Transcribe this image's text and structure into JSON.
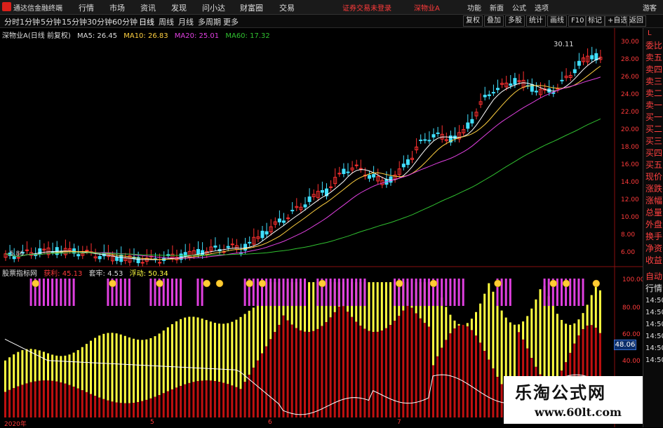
{
  "app": {
    "title": "通达信金融终端",
    "login_status": "证券交易未登录",
    "stock": "深物业A"
  },
  "menu": [
    "行情",
    "市场",
    "资讯",
    "发现",
    "问小达",
    "财富圈",
    "交易"
  ],
  "right_menu": [
    "功能",
    "新面",
    "公式",
    "选项",
    "游客"
  ],
  "periods": [
    "分时",
    "1分钟",
    "5分钟",
    "15分钟",
    "30分钟",
    "60分钟",
    "日线",
    "周线",
    "月线",
    "多周期",
    "更多"
  ],
  "active_period": "日线",
  "right_tools": [
    "复权",
    "叠加",
    "多股",
    "统计",
    "画线",
    "F10",
    "标记",
    "+自选",
    "返回"
  ],
  "legend1": {
    "name": "深物业A(日线 前复权)",
    "ma5": "MA5: 26.45",
    "ma10": "MA10: 26.83",
    "ma20": "MA20: 25.01",
    "ma60": "MA60: 17.32"
  },
  "legend2": {
    "name": "股票指标网",
    "a": "获利: 45.13",
    "b": "套牢: 4.53",
    "c": "浮动: 50.34"
  },
  "side_items": [
    "委比",
    "卖五",
    "卖四",
    "卖三",
    "卖二",
    "卖一",
    "买一",
    "买二",
    "买三",
    "买四",
    "买五",
    "现价",
    "涨跌",
    "涨幅",
    "总量",
    "外盘",
    "换手",
    "净资",
    "收益"
  ],
  "side_bottom": [
    "自动",
    "行情",
    "14:50",
    "14:50",
    "14:50",
    "14:50",
    "14:50",
    "14:50"
  ],
  "price_axis": [
    "30.00",
    "28.00",
    "26.00",
    "24.00",
    "22.00",
    "20.00",
    "18.00",
    "16.00",
    "14.00",
    "12.00",
    "10.00",
    "8.00",
    "6.00"
  ],
  "ind_axis": [
    "100.00",
    "80.00",
    "60.00",
    "40.00"
  ],
  "high_label": "30.11",
  "low_label": "5.86",
  "cur_value": "48.06",
  "dates": [
    "2020年",
    "5",
    "6",
    "7"
  ],
  "colors": {
    "up": "#ff3030",
    "down": "#40e0ff",
    "ma5": "#ffffff",
    "ma10": "#ffd040",
    "ma20": "#e040e0",
    "ma60": "#30c030",
    "yellow": "#ffff40",
    "red": "#c01010",
    "magenta": "#e040e0"
  },
  "watermark": {
    "cn": "乐淘公式网",
    "url": "www.60lt.com"
  }
}
